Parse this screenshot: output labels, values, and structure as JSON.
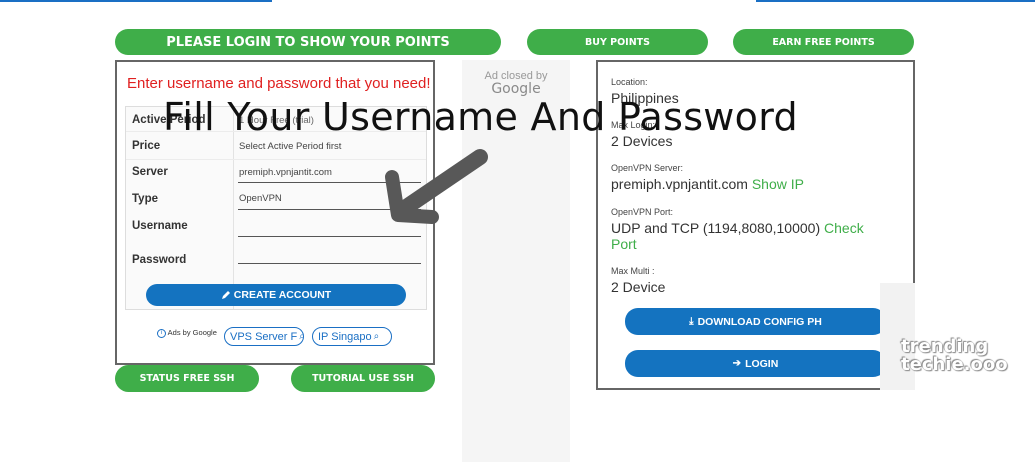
{
  "header": {
    "login_points": "PLEASE LOGIN TO SHOW YOUR POINTS",
    "buy_points": "BUY POINTS",
    "earn_points": "EARN FREE POINTS"
  },
  "ad": {
    "closed_by": "Ad closed by",
    "google": "Google"
  },
  "form": {
    "error": "Enter username and password that you need!",
    "fields": [
      {
        "label": "Active Period",
        "value": "1 Hour Free (trial)"
      },
      {
        "label": "Price",
        "value": "Select Active Period first"
      },
      {
        "label": "Server",
        "value": "premiph.vpnjantit.com"
      },
      {
        "label": "Type",
        "value": "OpenVPN"
      },
      {
        "label": "Username",
        "value": ""
      },
      {
        "label": "Password",
        "value": ""
      }
    ],
    "create_button": "CREATE ACCOUNT",
    "ads_by": "Ads by Google",
    "ad_links": [
      "VPS Server F",
      "IP Singapo"
    ]
  },
  "bottom_buttons": {
    "status": "STATUS FREE SSH",
    "tutorial": "TUTORIAL USE SSH"
  },
  "info": {
    "location_label": "Location:",
    "location_value": "Philippines",
    "max_login_label": "Max Login:",
    "max_login_value": "2 Devices",
    "server_label": "OpenVPN Server:",
    "server_value": "premiph.vpnjantit.com",
    "show_ip": "Show IP",
    "port_label": "OpenVPN Port:",
    "port_value": "UDP and TCP (1194,8080,10000)",
    "check_port_1": "Check",
    "check_port_2": "Port",
    "multi_label": "Max Multi :",
    "multi_value": "2 Device",
    "download_button": "DOWNLOAD CONFIG PH",
    "login_button": "LOGIN"
  },
  "overlay": "Fill Your Username And Password",
  "watermark": {
    "line1": "trending",
    "line2": "techie.ooo"
  },
  "colors": {
    "green": "#3fae49",
    "blue": "#1473c0",
    "error": "#e02020"
  }
}
